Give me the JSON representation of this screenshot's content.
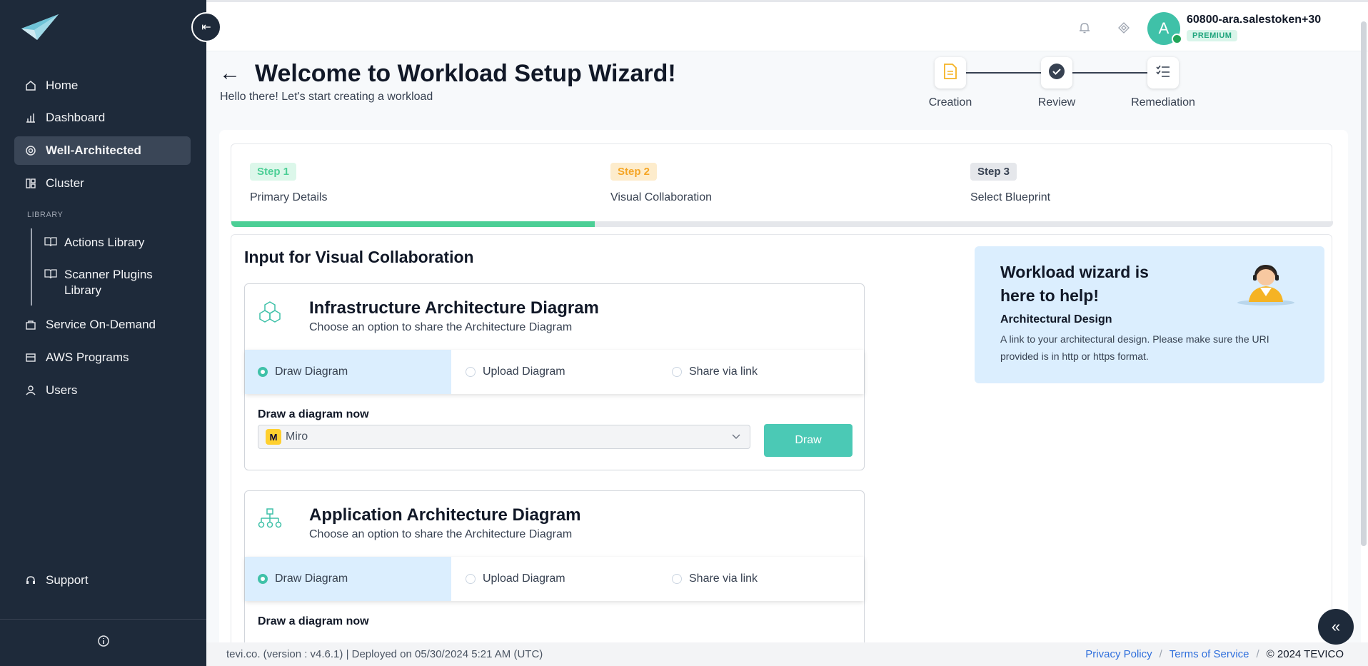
{
  "sidebar": {
    "nav": [
      {
        "label": "Home",
        "icon": "home-icon"
      },
      {
        "label": "Dashboard",
        "icon": "bar-chart-icon"
      },
      {
        "label": "Well-Architected",
        "icon": "target-icon",
        "active": true
      },
      {
        "label": "Cluster",
        "icon": "cluster-icon"
      }
    ],
    "library_label": "LIBRARY",
    "library_items": [
      {
        "label": "Actions Library",
        "icon": "book-icon"
      },
      {
        "label": "Scanner Plugins Library",
        "icon": "book-icon"
      }
    ],
    "nav2": [
      {
        "label": "Service On-Demand",
        "icon": "bag-icon"
      },
      {
        "label": "AWS Programs",
        "icon": "cards-icon"
      },
      {
        "label": "Users",
        "icon": "user-icon"
      }
    ],
    "support": "Support"
  },
  "topbar": {
    "avatar_letter": "A",
    "username": "60800-ara.salestoken+30",
    "badge": "PREMIUM"
  },
  "page": {
    "title": "Welcome to Workload Setup Wizard!",
    "subtitle": "Hello there! Let's start creating a workload"
  },
  "stepper": {
    "stages": [
      "Creation",
      "Review",
      "Remediation"
    ]
  },
  "steps": [
    {
      "badge": "Step 1",
      "name": "Primary Details",
      "color": "#4ccf96",
      "bg": "#dcf7ea"
    },
    {
      "badge": "Step 2",
      "name": "Visual Collaboration",
      "color": "#f5a524",
      "bg": "#fdeccc"
    },
    {
      "badge": "Step 3",
      "name": "Select Blueprint",
      "color": "#374151",
      "bg": "#e5e7eb"
    }
  ],
  "progress_fraction": 0.33,
  "section_title": "Input for Visual Collaboration",
  "diagrams": [
    {
      "title": "Infrastructure Architecture Diagram",
      "subtitle": "Choose an option to share the Architecture Diagram",
      "options": [
        "Draw Diagram",
        "Upload Diagram",
        "Share via link"
      ],
      "draw_label": "Draw a diagram now",
      "tool": "Miro",
      "button": "Draw"
    },
    {
      "title": "Application Architecture Diagram",
      "subtitle": "Choose an option to share the Architecture Diagram",
      "options": [
        "Draw Diagram",
        "Upload Diagram",
        "Share via link"
      ],
      "draw_label": "Draw a diagram now"
    }
  ],
  "help": {
    "title": "Workload wizard is here to help!",
    "subtitle": "Architectural Design",
    "text": "A link to your architectural design. Please make sure the URI provided is in http or https format."
  },
  "footer": {
    "left": "tevi.co. (version : v4.6.1) | Deployed on 05/30/2024 5:21 AM (UTC)",
    "privacy": "Privacy Policy",
    "terms": "Terms of Service",
    "copyright": "© 2024 TEVICO",
    "sep": "/"
  }
}
